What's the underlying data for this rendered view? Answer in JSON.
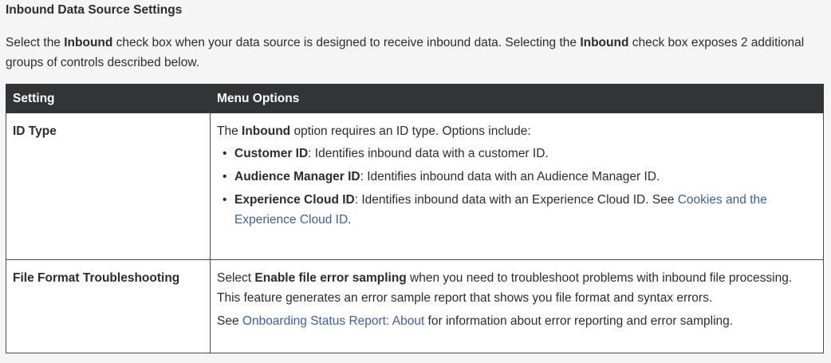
{
  "heading": "Inbound Data Source Settings",
  "intro": {
    "part1": "Select the ",
    "bold1": "Inbound",
    "part2": " check box when your data source is designed to receive inbound data. Selecting the ",
    "bold2": "Inbound",
    "part3": " check box exposes 2 additional groups of controls described below."
  },
  "table": {
    "headers": [
      "Setting",
      "Menu Options"
    ],
    "rows": [
      {
        "setting": "ID Type",
        "intro_pre": "The ",
        "intro_bold": "Inbound",
        "intro_post": " option requires an ID type. Options include:",
        "options": [
          {
            "term": "Customer ID",
            "desc": ": Identifies inbound data with a customer ID."
          },
          {
            "term": "Audience Manager ID",
            "desc": ": Identifies inbound data with an Audience Manager ID."
          },
          {
            "term": "Experience Cloud ID",
            "desc": ": Identifies inbound data with an Experience Cloud ID. See ",
            "link": "Cookies and the Experience Cloud ID",
            "after": "."
          }
        ]
      },
      {
        "setting": "File Format Troubleshooting",
        "p1_pre": "Select ",
        "p1_bold": "Enable file error sampling",
        "p1_post": " when you need to troubleshoot problems with inbound file processing. This feature generates an error sample report that shows you file format and syntax errors.",
        "p2_pre": "See ",
        "p2_link": "Onboarding Status Report: About",
        "p2_post": " for information about error reporting and error sampling."
      }
    ]
  },
  "colors": {
    "header_bg": "#323535",
    "link": "#3a5ea8",
    "page_bg": "#f5f5f5"
  }
}
